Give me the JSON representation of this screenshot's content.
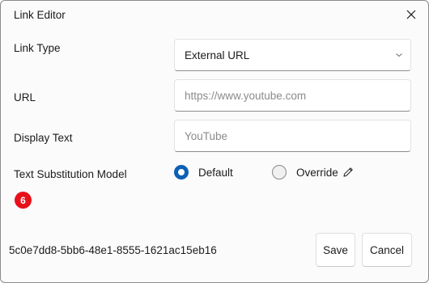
{
  "window": {
    "title": "Link Editor"
  },
  "form": {
    "link_type": {
      "label": "Link Type",
      "value": "External URL"
    },
    "url": {
      "label": "URL",
      "placeholder": "https://www.youtube.com"
    },
    "display_text": {
      "label": "Display Text",
      "placeholder": "YouTube"
    },
    "substitution": {
      "label": "Text Substitution Model",
      "options": [
        {
          "label": "Default",
          "selected": true
        },
        {
          "label": "Override",
          "selected": false
        }
      ]
    }
  },
  "badge": {
    "count": "6",
    "color": "#e8101a"
  },
  "footer": {
    "guid": "5c0e7dd8-5bb6-48e1-8555-1621ac15eb16",
    "save_label": "Save",
    "cancel_label": "Cancel"
  },
  "colors": {
    "accent": "#0f5fb5"
  },
  "icons": {
    "close": "close-icon",
    "chevron": "chevron-down-icon",
    "edit": "pencil-icon"
  }
}
